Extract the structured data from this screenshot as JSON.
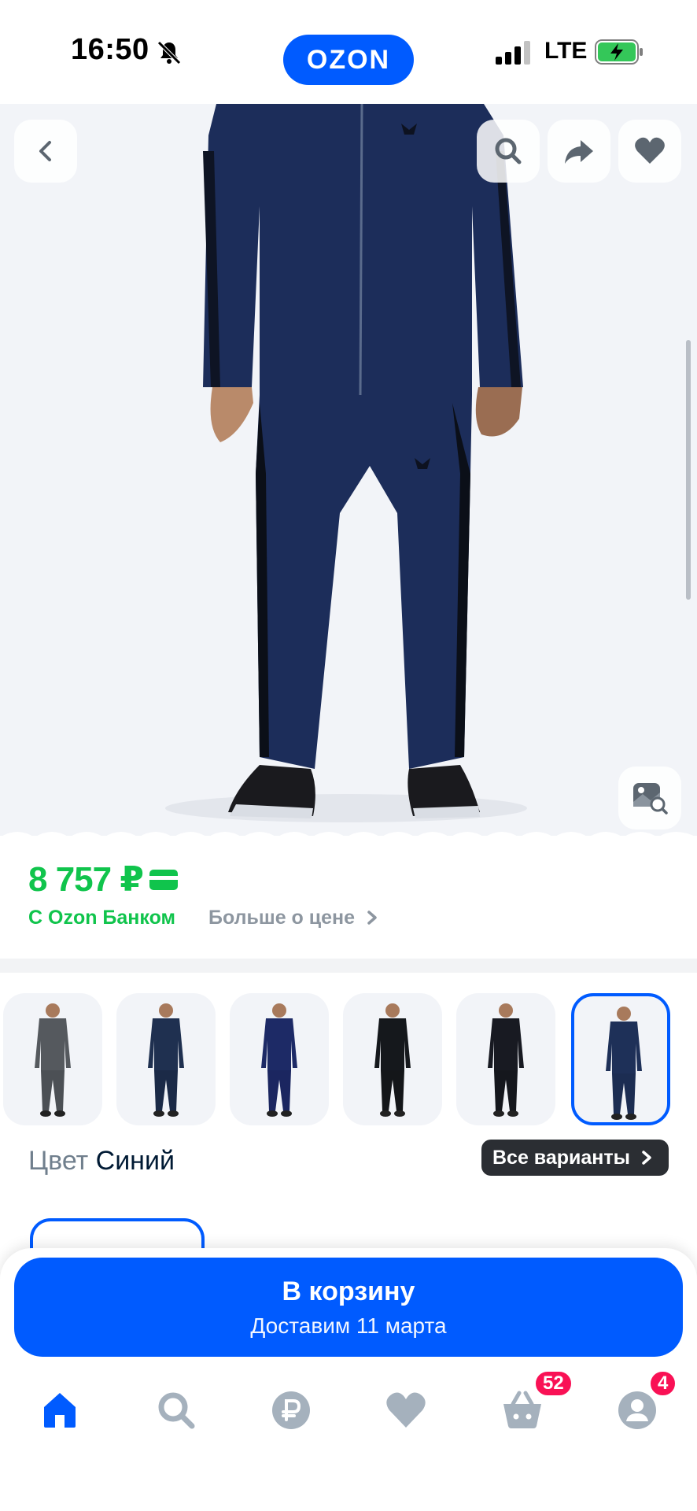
{
  "status_bar": {
    "time": "16:50",
    "network": "LTE",
    "logo": "OZON"
  },
  "hero": {
    "buttons": [
      "back-icon",
      "search-icon",
      "share-icon",
      "heart-icon",
      "image-search-icon"
    ]
  },
  "price": {
    "amount": "8 757 ₽",
    "bank_label": "С Ozon Банком",
    "more_label": "Больше о цене",
    "color": "#10c44c"
  },
  "variants": {
    "color_label": "Цвет",
    "color_value": "Синий",
    "all_variants": "Все варианты",
    "thumbnails": [
      {
        "color": "#55595e",
        "pants": "#4c5055"
      },
      {
        "color": "#1f3050",
        "pants": "#1b2a47"
      },
      {
        "color": "#1d2a66",
        "pants": "#1b2660"
      },
      {
        "color": "#15181c",
        "pants": "#141619"
      },
      {
        "color": "#181a22",
        "pants": "#15171d"
      },
      {
        "color": "#1e3058",
        "pants": "#1c2d52"
      }
    ]
  },
  "cart": {
    "label": "В корзину",
    "delivery": "Доставим 11 марта"
  },
  "nav": {
    "items": [
      "home-icon",
      "search-icon",
      "ruble-icon",
      "favorites-icon",
      "cart-icon",
      "profile-icon"
    ],
    "cart_badge": "52",
    "profile_badge": "4",
    "active_color": "#005bff",
    "inactive_color": "#a5b1bd"
  }
}
